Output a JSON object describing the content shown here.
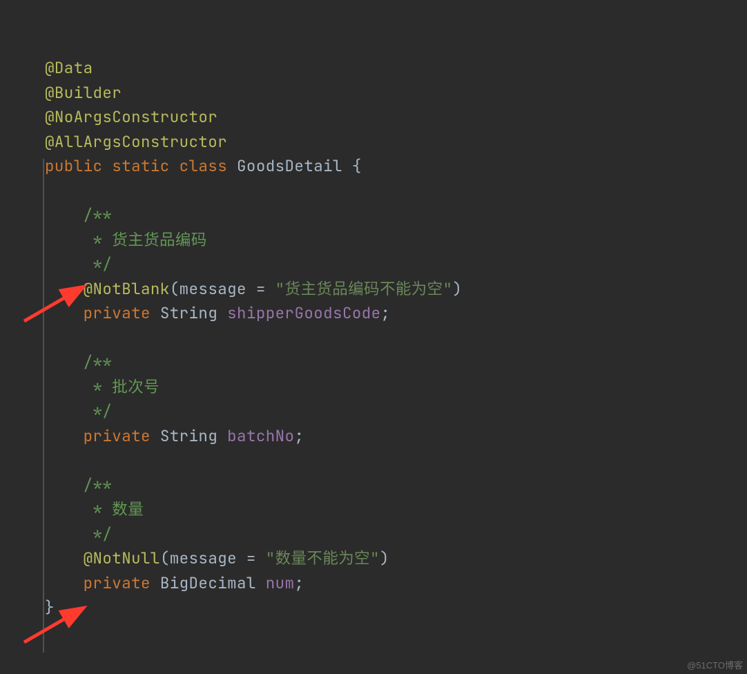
{
  "code": {
    "annotations": [
      "@Data",
      "@Builder",
      "@NoArgsConstructor",
      "@AllArgsConstructor"
    ],
    "modifiers": "public static class",
    "className": "GoodsDetail",
    "openBrace": " {",
    "fields": [
      {
        "doc1": "/**",
        "doc2": " * 货主货品编码",
        "doc3": " */",
        "ann": "@NotBlank",
        "annOpen": "(",
        "paramName": "message",
        "eq": " = ",
        "msg": "\"货主货品编码不能为空\"",
        "annClose": ")",
        "mod": "private",
        "type": "String",
        "name": "shipperGoodsCode",
        "semi": ";"
      },
      {
        "doc1": "/**",
        "doc2": " * 批次号",
        "doc3": " */",
        "ann": "",
        "mod": "private",
        "type": "String",
        "name": "batchNo",
        "semi": ";"
      },
      {
        "doc1": "/**",
        "doc2": " * 数量",
        "doc3": " */",
        "ann": "@NotNull",
        "annOpen": "(",
        "paramName": "message",
        "eq": " = ",
        "msg": "\"数量不能为空\"",
        "annClose": ")",
        "mod": "private",
        "type": "BigDecimal",
        "name": "num",
        "semi": ";"
      }
    ],
    "closeBrace": "}"
  },
  "watermark": "@51CTO博客"
}
